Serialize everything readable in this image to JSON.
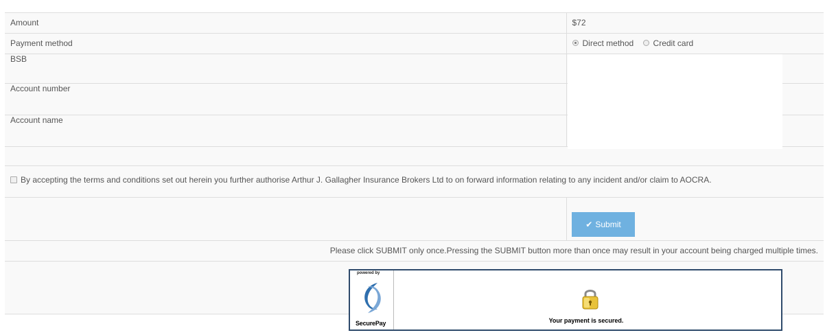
{
  "form": {
    "amount_label": "Amount",
    "amount_value": "$72",
    "payment_method_label": "Payment method",
    "payment_options": [
      {
        "label": "Direct method",
        "selected": true
      },
      {
        "label": "Credit card",
        "selected": false
      }
    ],
    "bsb_label": "BSB",
    "account_number_label": "Account number",
    "account_name_label": "Account name"
  },
  "terms": {
    "text": "By accepting the terms and conditions set out herein you further authorise Arthur J. Gallagher Insurance Brokers Ltd to on forward information relating to any incident and/or claim to AOCRA.",
    "checked": false
  },
  "submit": {
    "label": "Submit",
    "icon": "check-icon",
    "color": "#6fb1e0"
  },
  "notice": "Please click SUBMIT only once.Pressing the SUBMIT button more than once may result in your account being charged multiple times.",
  "securepay": {
    "powered_by": "powered by",
    "brand": "SecurePay",
    "secured_text": "Your payment is secured."
  }
}
